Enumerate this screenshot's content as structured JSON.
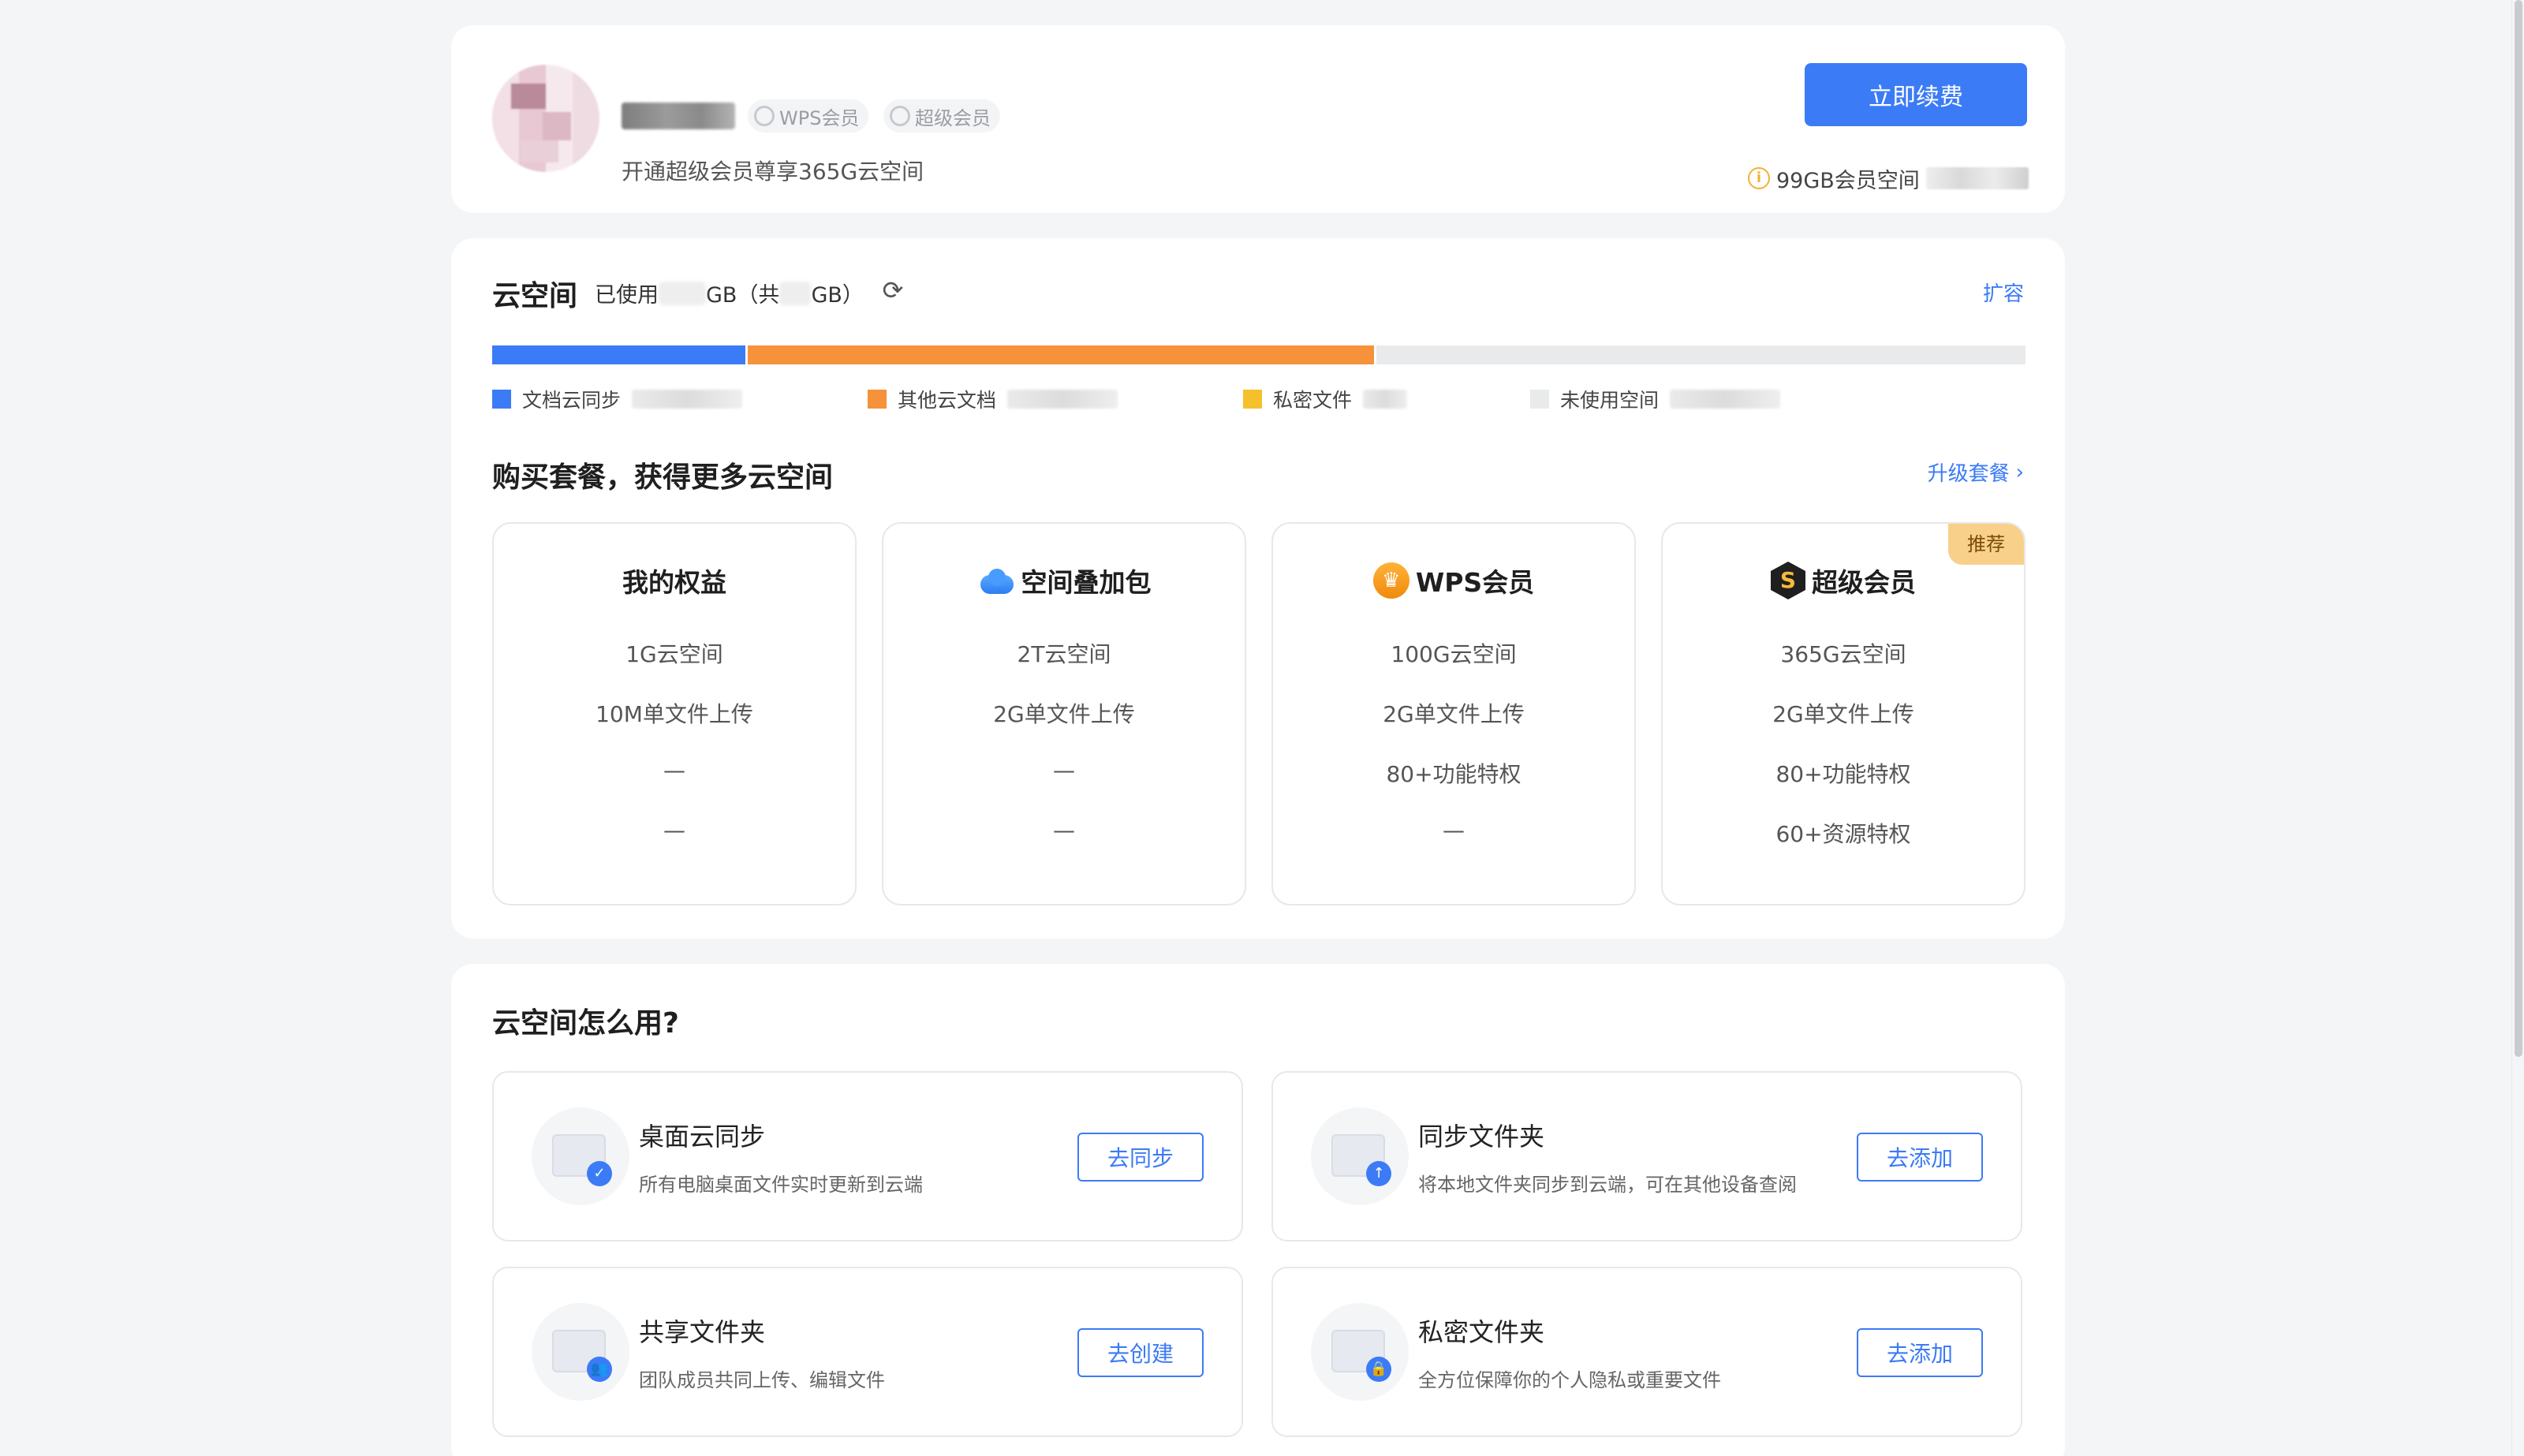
{
  "profile": {
    "badge_wps": "WPS会员",
    "badge_super": "超级会员",
    "subtitle": "开通超级会员尊享365G云空间",
    "renew_button": "立即续费",
    "member_space_text": "99GB会员空间"
  },
  "space": {
    "title": "云空间",
    "used_prefix": "已使用",
    "used_mid": "GB（共",
    "used_suffix": "GB）",
    "expand_link": "扩容",
    "usage_bar": [
      {
        "category": "文档云同步",
        "fraction": 0.165,
        "color": "#3b7bf6"
      },
      {
        "category": "其他云文档",
        "fraction": 0.41,
        "color": "#f5923a"
      },
      {
        "category": "私密文件",
        "fraction": 0.0,
        "color": "#f5c02c"
      }
    ],
    "legend": [
      {
        "label": "文档云同步",
        "color": "#3b7bf6"
      },
      {
        "label": "其他云文档",
        "color": "#f5923a"
      },
      {
        "label": "私密文件",
        "color": "#f5c02c"
      },
      {
        "label": "未使用空间",
        "color": "#e9eaec"
      }
    ],
    "buy_title": "购买套餐，获得更多云空间",
    "upgrade_link": "升级套餐",
    "plans": [
      {
        "name": "我的权益",
        "icon": "none",
        "features": [
          "1G云空间",
          "10M单文件上传",
          "—",
          "—"
        ]
      },
      {
        "name": "空间叠加包",
        "icon": "cloud-icon",
        "features": [
          "2T云空间",
          "2G单文件上传",
          "—",
          "—"
        ]
      },
      {
        "name": "WPS会员",
        "icon": "crown-icon",
        "features": [
          "100G云空间",
          "2G单文件上传",
          "80+功能特权",
          "—"
        ]
      },
      {
        "name": "超级会员",
        "icon": "super-member-icon",
        "tag": "推荐",
        "features": [
          "365G云空间",
          "2G单文件上传",
          "80+功能特权",
          "60+资源特权"
        ]
      }
    ]
  },
  "howto": {
    "title": "云空间怎么用?",
    "tiles": [
      {
        "name": "桌面云同步",
        "desc": "所有电脑桌面文件实时更新到云端",
        "button": "去同步",
        "icon": "desktop-sync-icon",
        "sub_glyph": "✓"
      },
      {
        "name": "同步文件夹",
        "desc": "将本地文件夹同步到云端，可在其他设备查阅",
        "button": "去添加",
        "icon": "sync-folder-icon",
        "sub_glyph": "↑"
      },
      {
        "name": "共享文件夹",
        "desc": "团队成员共同上传、编辑文件",
        "button": "去创建",
        "icon": "shared-folder-icon",
        "sub_glyph": "👥"
      },
      {
        "name": "私密文件夹",
        "desc": "全方位保障你的个人隐私或重要文件",
        "button": "去添加",
        "icon": "private-folder-icon",
        "sub_glyph": "🔒"
      }
    ]
  }
}
